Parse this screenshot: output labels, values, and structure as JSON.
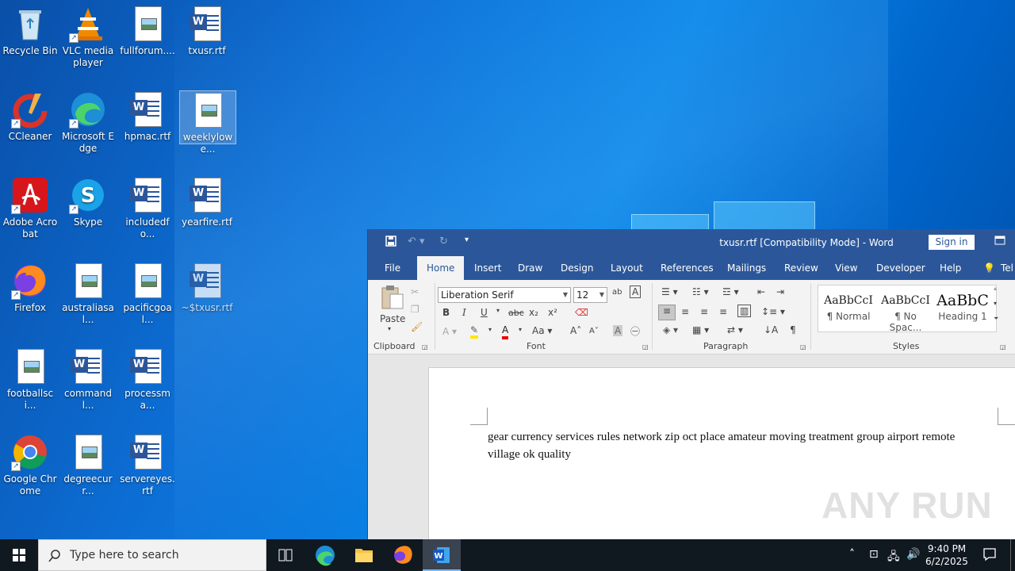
{
  "desktop": {
    "icons": [
      {
        "label": "Recycle Bin"
      },
      {
        "label": "VLC media player"
      },
      {
        "label": "fullforum...."
      },
      {
        "label": "txusr.rtf"
      },
      {
        "label": "CCleaner"
      },
      {
        "label": "Microsoft Edge"
      },
      {
        "label": "hpmac.rtf"
      },
      {
        "label": "weeklylowe..."
      },
      {
        "label": "Adobe Acrobat"
      },
      {
        "label": "Skype"
      },
      {
        "label": "includedfo..."
      },
      {
        "label": "yearfire.rtf"
      },
      {
        "label": "Firefox"
      },
      {
        "label": "australiasal..."
      },
      {
        "label": "pacificgoal..."
      },
      {
        "label": "~$txusr.rtf"
      },
      {
        "label": "footballsci..."
      },
      {
        "label": "commandl..."
      },
      {
        "label": "processma..."
      },
      {
        "label": "Google Chrome"
      },
      {
        "label": "degreecurr..."
      },
      {
        "label": "servereyes.rtf"
      }
    ]
  },
  "word": {
    "title": "txusr.rtf [Compatibility Mode] - Word",
    "sign_in": "Sign in",
    "tabs": [
      "File",
      "Home",
      "Insert",
      "Draw",
      "Design",
      "Layout",
      "References",
      "Mailings",
      "Review",
      "View",
      "Developer",
      "Help",
      "Tel"
    ],
    "ribbon": {
      "paste": "Paste",
      "clipboard": "Clipboard",
      "font_group": "Font",
      "paragraph_group": "Paragraph",
      "styles_group": "Styles",
      "font_name": "Liberation Serif",
      "font_size": "12",
      "styles": [
        {
          "preview": "AaBbCcI",
          "name": "¶ Normal"
        },
        {
          "preview": "AaBbCcI",
          "name": "¶ No Spac..."
        },
        {
          "preview": "AaBbC",
          "name": "Heading 1"
        }
      ]
    },
    "document_text": "gear currency services rules network     zip     oct place amateur moving treatment group     airport remote village  ok quality"
  },
  "watermark": "ANY RUN",
  "taskbar": {
    "search_placeholder": "Type here to search",
    "time": "9:40 PM",
    "date": "6/2/2025"
  }
}
